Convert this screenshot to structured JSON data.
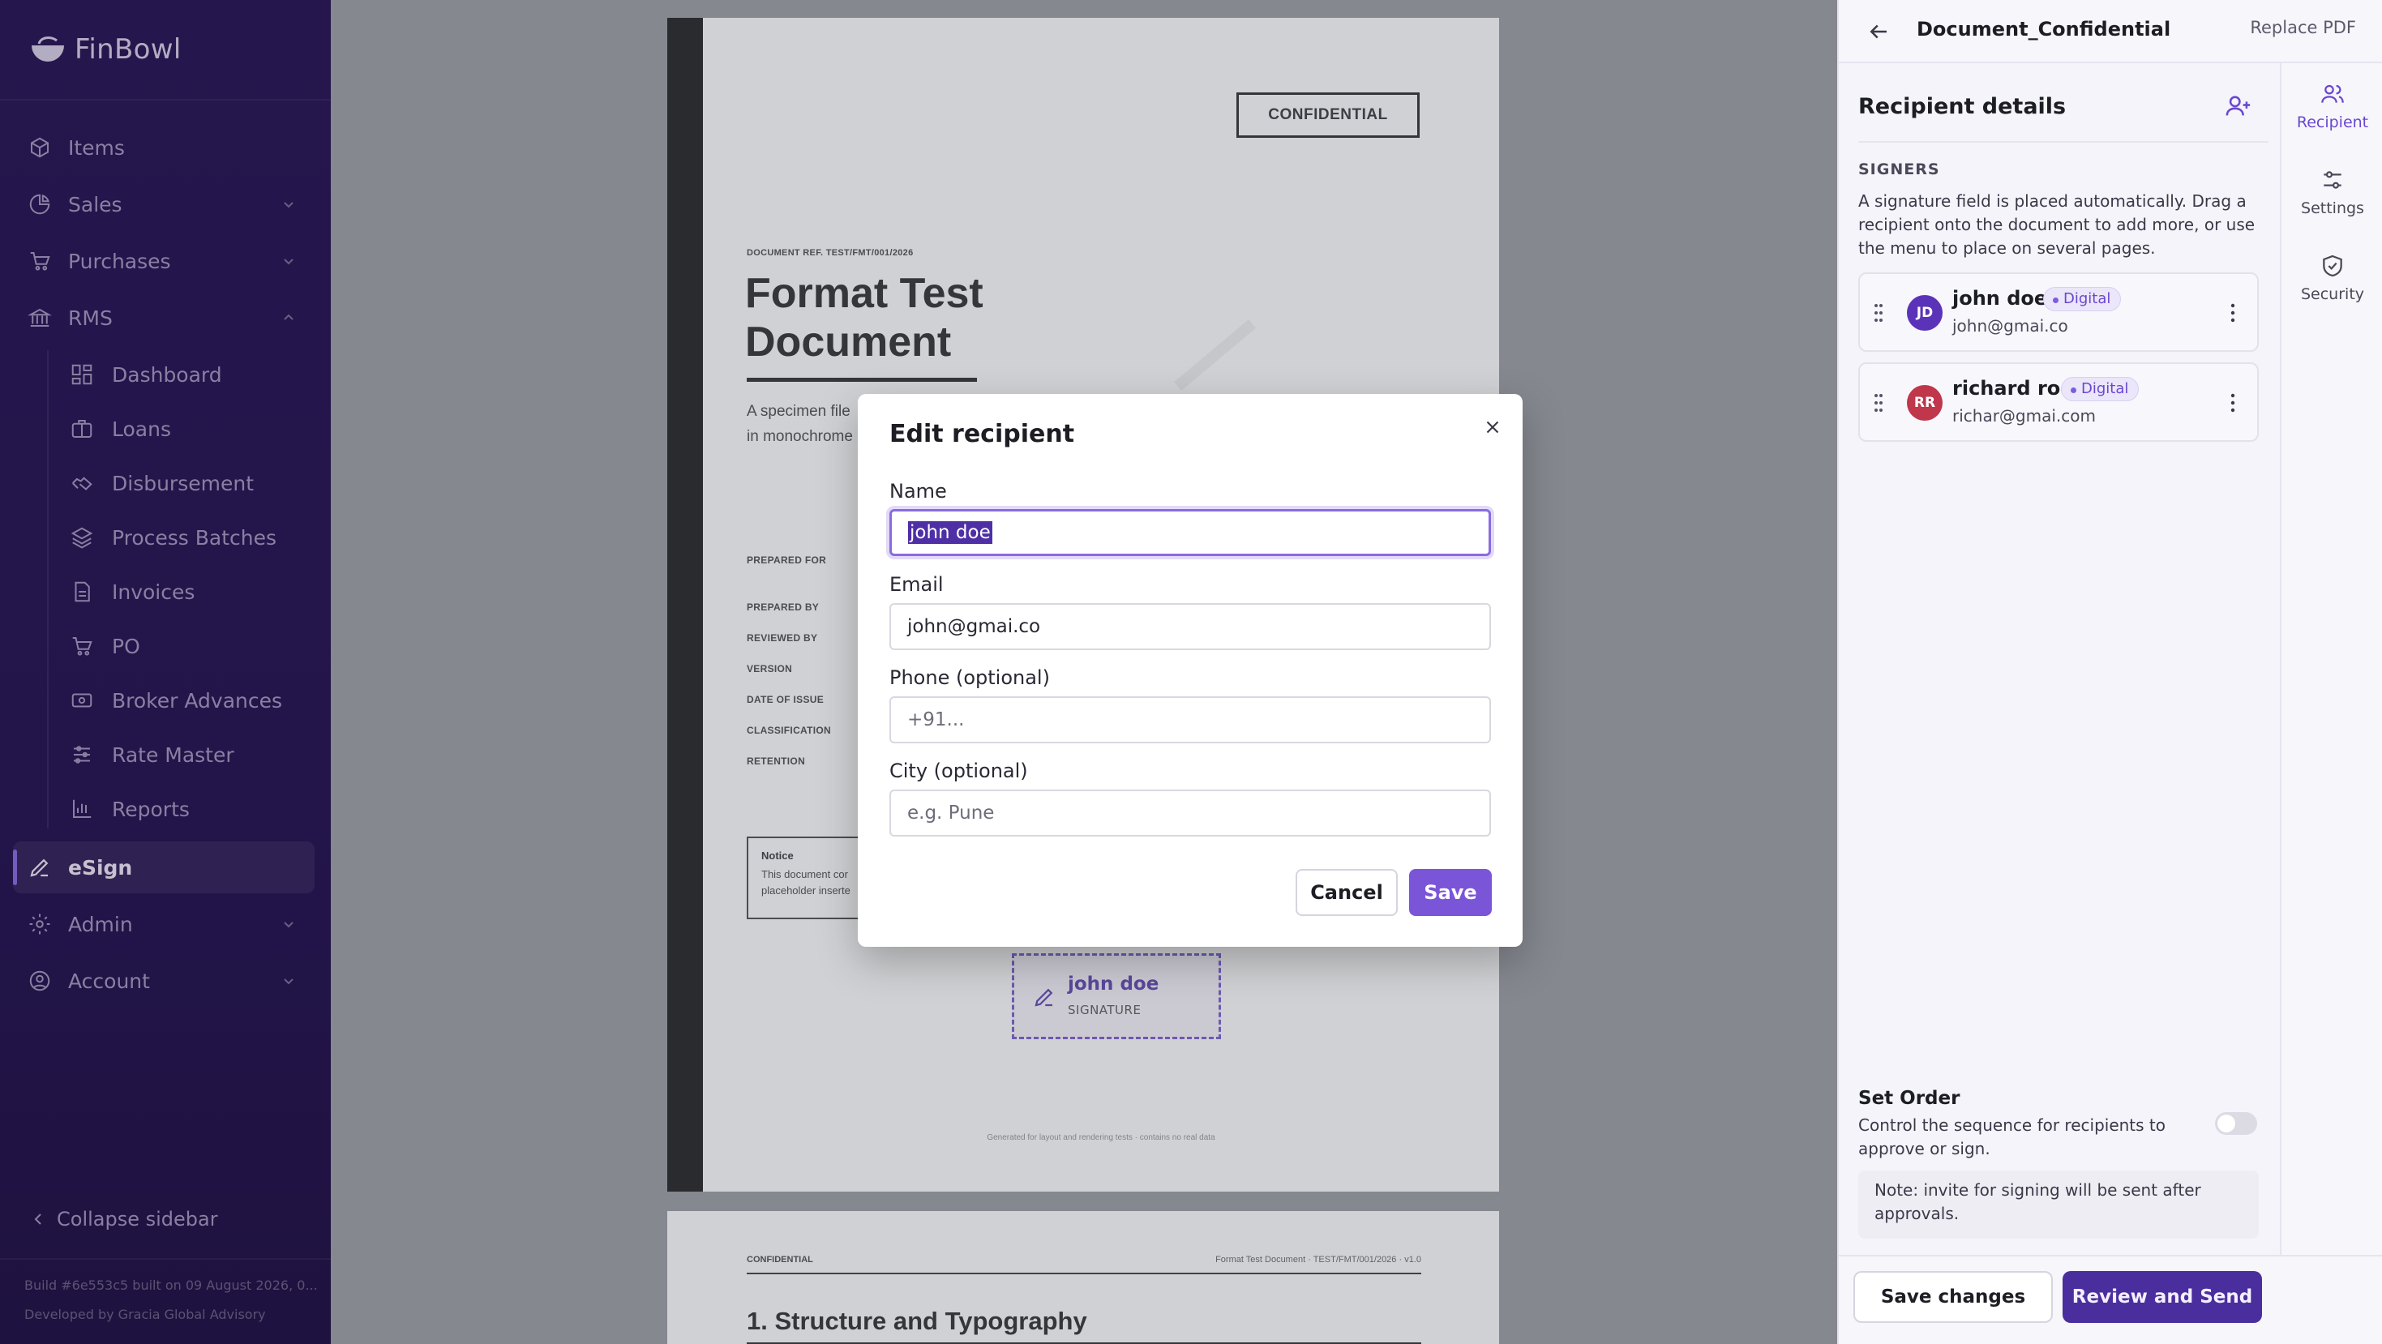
{
  "app": {
    "name": "FinBowl"
  },
  "sidebar": {
    "items": [
      {
        "label": "Items",
        "icon": "cube-icon"
      },
      {
        "label": "Sales",
        "icon": "pie-chart-icon"
      },
      {
        "label": "Purchases",
        "icon": "cart-icon"
      },
      {
        "label": "RMS",
        "icon": "bank-icon"
      },
      {
        "label": "Dashboard",
        "icon": "dashboard-icon"
      },
      {
        "label": "Loans",
        "icon": "briefcase-icon"
      },
      {
        "label": "Disbursement",
        "icon": "handshake-icon"
      },
      {
        "label": "Process Batches",
        "icon": "layers-icon"
      },
      {
        "label": "Invoices",
        "icon": "file-icon"
      },
      {
        "label": "PO",
        "icon": "cart-icon"
      },
      {
        "label": "Broker Advances",
        "icon": "banknote-icon"
      },
      {
        "label": "Rate Master",
        "icon": "sliders-icon"
      },
      {
        "label": "Reports",
        "icon": "bar-chart-icon"
      },
      {
        "label": "eSign",
        "icon": "pen-icon",
        "active": true
      },
      {
        "label": "Admin",
        "icon": "gear-icon"
      },
      {
        "label": "Account",
        "icon": "user-circle-icon"
      }
    ],
    "collapse_label": "Collapse sidebar",
    "build_info": "Build #6e553c5 built on 09 August 2026, 0...",
    "developed_by": "Developed by Gracia Global Advisory"
  },
  "document": {
    "confidential_box": "CONFIDENTIAL",
    "doc_ref": "DOCUMENT REF. TEST/FMT/001/2026",
    "title": "Format Test Document",
    "desc_line1": "A specimen file",
    "desc_line2": "in monochrome",
    "meta_labels": [
      "PREPARED FOR",
      "PREPARED BY",
      "REVIEWED BY",
      "VERSION",
      "DATE OF ISSUE",
      "CLASSIFICATION",
      "RETENTION"
    ],
    "notice_title": "Notice",
    "notice_line1": "This document cor",
    "notice_line2": "placeholder inserte",
    "signature_name": "john doe",
    "signature_label": "SIGNATURE",
    "footer_note": "Generated for layout and rendering tests · contains no real data",
    "page2_left": "CONFIDENTIAL",
    "page2_right": "Format Test Document  ·  TEST/FMT/001/2026  ·  v1.0",
    "page2_heading": "1. Structure and Typography"
  },
  "right_panel": {
    "doc_name": "Document_Confidential",
    "replace_label": "Replace PDF",
    "section_title": "Recipient details",
    "signers_heading": "SIGNERS",
    "signers_desc": "A signature field is placed automatically. Drag a recipient onto the document to add more, or use the menu to place on several pages.",
    "recipients": [
      {
        "initials": "JD",
        "name": "john doe",
        "email": "john@gmai.co",
        "badge": "Digital",
        "color": "#5b33b8"
      },
      {
        "initials": "RR",
        "name": "richard roe",
        "email": "richar@gmai.com",
        "badge": "Digital",
        "color": "#c0364a"
      }
    ],
    "tabs": [
      {
        "label": "Recipient",
        "icon": "users-icon",
        "active": true
      },
      {
        "label": "Settings",
        "icon": "sliders-icon"
      },
      {
        "label": "Security",
        "icon": "shield-check-icon"
      }
    ],
    "set_order_title": "Set Order",
    "set_order_desc": "Control the sequence for recipients to approve or sign.",
    "set_order_enabled": false,
    "note": "Note: invite for signing will be sent after approvals.",
    "save_changes": "Save changes",
    "review_send": "Review and Send"
  },
  "modal": {
    "title": "Edit recipient",
    "fields": [
      {
        "label": "Name",
        "value": "john doe",
        "placeholder": ""
      },
      {
        "label": "Email",
        "value": "john@gmai.co",
        "placeholder": ""
      },
      {
        "label": "Phone (optional)",
        "value": "",
        "placeholder": "+91..."
      },
      {
        "label": "City (optional)",
        "value": "",
        "placeholder": "e.g. Pune"
      }
    ],
    "cancel": "Cancel",
    "save": "Save"
  },
  "colors": {
    "accent": "#7b55d8",
    "sidebar_bg": "#2b1a58",
    "primary_dark": "#4b2e9e"
  }
}
